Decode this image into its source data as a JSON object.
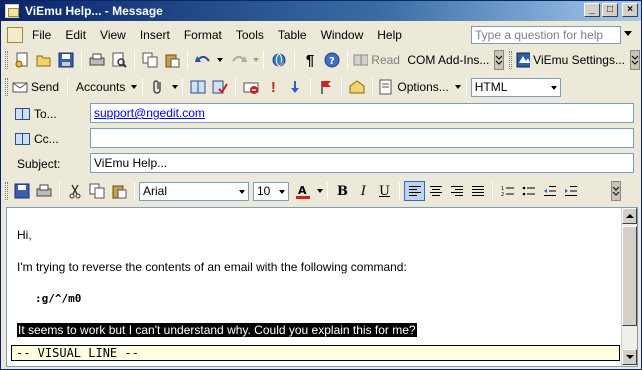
{
  "window": {
    "title": "ViEmu Help... - Message",
    "minimize_glyph": "_",
    "maximize_glyph": "□",
    "close_glyph": "×"
  },
  "menu": {
    "items": [
      {
        "label": "File"
      },
      {
        "label": "Edit"
      },
      {
        "label": "View"
      },
      {
        "label": "Insert"
      },
      {
        "label": "Format"
      },
      {
        "label": "Tools"
      },
      {
        "label": "Table"
      },
      {
        "label": "Window"
      },
      {
        "label": "Help"
      }
    ],
    "help_search_placeholder": "Type a question for help"
  },
  "standard_toolbar": {
    "read_label": "Read",
    "com_addins_label": "COM Add-Ins...",
    "viemu_settings_label": "ViEmu Settings..."
  },
  "email_toolbar": {
    "send_label": "Send",
    "accounts_label": "Accounts",
    "options_label": "Options...",
    "format_value": "HTML"
  },
  "address": {
    "to_label": "To...",
    "to_value": "support@ngedit.com",
    "cc_label": "Cc...",
    "cc_value": "",
    "subject_label": "Subject:",
    "subject_value": "ViEmu Help..."
  },
  "format_toolbar": {
    "font": "Arial",
    "size": "10",
    "bold": "B",
    "italic": "I",
    "underline": "U",
    "active_alignment": "left"
  },
  "body": {
    "greeting": "Hi,",
    "line1": "I'm trying to reverse the contents of an email with the following command:",
    "command": ":g/^/m0",
    "selected_line": "It seems to work but I can't understand why. Could you explain this for me?",
    "vi_mode": "-- VISUAL LINE --"
  },
  "colors": {
    "titlebar_start": "#0a246a",
    "titlebar_end": "#a6caf0",
    "link": "#0000ff",
    "selection_bg": "#000000",
    "mode_line_bg": "#ffffe1"
  }
}
